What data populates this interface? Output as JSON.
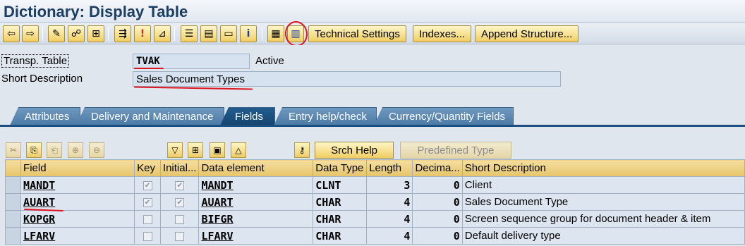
{
  "window": {
    "title": "Dictionary: Display Table"
  },
  "toolbar": {
    "icons": [
      "back-icon",
      "forward-icon",
      "change-icon",
      "other-object-icon",
      "activate-icon",
      "check-icon",
      "generate-icon",
      "where-used-icon",
      "hierarchy-icon",
      "object-list-icon",
      "display-object-icon",
      "info-icon",
      "contents-icon",
      "technical-settings-icon"
    ],
    "glyphs": {
      "back": "⇦",
      "forward": "⇨",
      "change": "✎",
      "other_object": "☍",
      "activate": "⊞",
      "check": "!",
      "generate": "⇶",
      "where_used": "⊿",
      "hierarchy": "☰",
      "object_list": "▤",
      "display_object": "▭",
      "info": "i",
      "contents": "▦",
      "tech": "▥"
    },
    "buttons": {
      "technical_settings": "Technical Settings",
      "indexes": "Indexes...",
      "append_structure": "Append Structure..."
    }
  },
  "header": {
    "transp_table_label": "Transp. Table",
    "table_name": "TVAK",
    "status": "Active",
    "short_desc_label": "Short Description",
    "short_desc_value": "Sales Document Types"
  },
  "tabs": [
    {
      "label": "Attributes",
      "active": false
    },
    {
      "label": "Delivery and Maintenance",
      "active": false
    },
    {
      "label": "Fields",
      "active": true
    },
    {
      "label": "Entry help/check",
      "active": false
    },
    {
      "label": "Currency/Quantity Fields",
      "active": false
    }
  ],
  "fields_toolbar": {
    "glyphs": {
      "cut": "✂",
      "copy": "⎘",
      "paste": "⎗",
      "insert_row": "⊕",
      "delete_row": "⊖",
      "filter": "▽",
      "new_row": "⊞",
      "detail": "▣",
      "sort": "△",
      "key": "⚷"
    },
    "srch_help": "Srch Help",
    "predefined_type": "Predefined Type"
  },
  "grid": {
    "columns": [
      "Field",
      "Key",
      "Initial...",
      "Data element",
      "Data Type",
      "Length",
      "Decima...",
      "Short Description"
    ],
    "rows": [
      {
        "field": "MANDT",
        "key": true,
        "initial": true,
        "data_element": "MANDT",
        "data_type": "CLNT",
        "length": "3",
        "decimals": "0",
        "desc": "Client"
      },
      {
        "field": "AUART",
        "key": true,
        "initial": true,
        "data_element": "AUART",
        "data_type": "CHAR",
        "length": "4",
        "decimals": "0",
        "desc": "Sales Document Type"
      },
      {
        "field": "KOPGR",
        "key": false,
        "initial": false,
        "data_element": "BIFGR",
        "data_type": "CHAR",
        "length": "4",
        "decimals": "0",
        "desc": "Screen sequence group for document header & item"
      },
      {
        "field": "LFARV",
        "key": false,
        "initial": false,
        "data_element": "LFARV",
        "data_type": "CHAR",
        "length": "4",
        "decimals": "0",
        "desc": "Default delivery type"
      }
    ]
  },
  "colors": {
    "title": "#1d3e63",
    "tab": "#4b7aa5",
    "tab_active": "#16456f",
    "annotation": "#e0141e",
    "button": "#f0cd63"
  }
}
